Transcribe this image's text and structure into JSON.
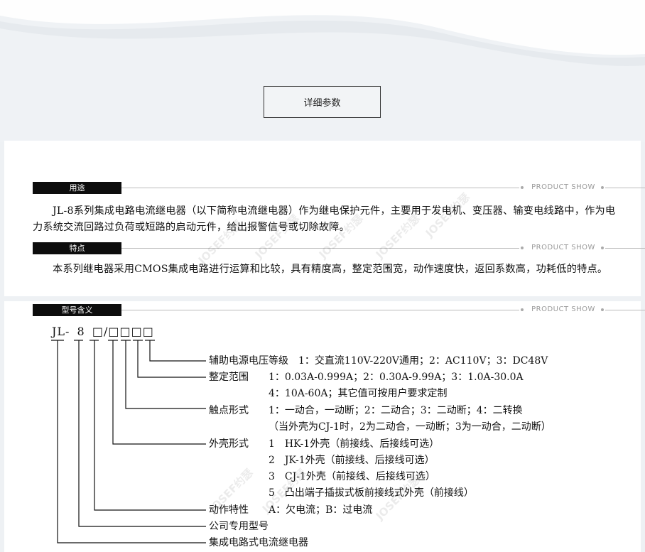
{
  "header": {
    "detail_button": "详细参数"
  },
  "sections": {
    "usage": {
      "tag": "用途",
      "product_show": "PRODUCT SHOW",
      "text": "JL-8系列集成电路电流继电器（以下简称电流继电器）作为继电保护元件，主要用于发电机、变压器、输变电线路中，作为电力系统交流回路过负荷或短路的启动元件，给出报警信号或切除故障。"
    },
    "features": {
      "tag": "特点",
      "product_show": "PRODUCT SHOW",
      "text": "本系列继电器采用CMOS集成电路进行运算和比较，具有精度高，整定范围宽，动作速度快，返回系数高，功耗低的特点。"
    },
    "model": {
      "tag": "型号含义",
      "product_show": "PRODUCT SHOW"
    }
  },
  "model_diagram": {
    "code": {
      "p1": "JL-",
      "p2": "8",
      "p3": "□/□□□□"
    },
    "items": [
      {
        "name": "辅助电源电压等级",
        "desc": "1：交直流110V-220V通用；2：AC110V；3：DC48V"
      },
      {
        "name": "整定范围",
        "desc": "1：0.03A-0.999A；2：0.30A-9.99A；3：1.0A-30.0A",
        "desc2": "4：10A-60A；其它值可按用户要求定制"
      },
      {
        "name": "触点形式",
        "desc": "1：一动合，一动断；2：二动合；3：二动断；4：二转换",
        "desc2": "（当外壳为CJ-1时，2为二动合，一动断；3为一动合，二动断）"
      },
      {
        "name": "外壳形式",
        "desc": "1　HK-1外壳（前接线、后接线可选）",
        "desc2": "2　JK-1外壳（前接线、后接线可选）",
        "desc3": "3　CJ-1外壳（前接线、后接线可选）",
        "desc4": "5　凸出端子插拔式板前接线式外壳（前接线）"
      },
      {
        "name": "动作特性",
        "desc": "A：欠电流；B：过电流"
      },
      {
        "name": "公司专用型号",
        "desc": ""
      },
      {
        "name": "集成电路式电流继电器",
        "desc": ""
      }
    ]
  },
  "watermark_text": "JOSEF约瑟"
}
